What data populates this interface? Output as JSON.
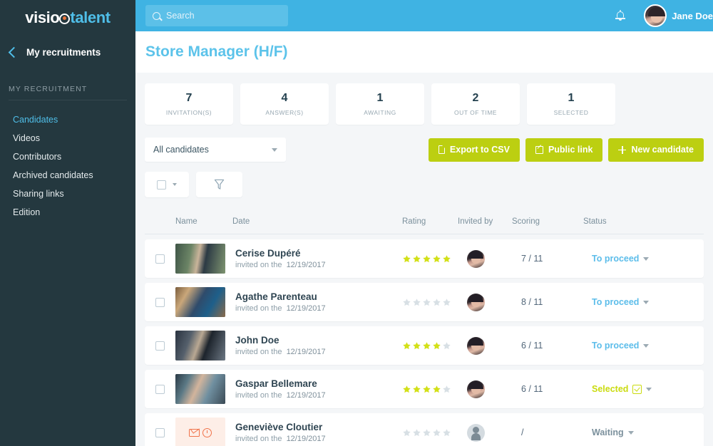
{
  "brand": {
    "logo_part1": "visio",
    "logo_part2": "talent",
    "accent_blue": "#4FBEE8",
    "accent_green": "#BCCF11",
    "sidebar_bg": "#24383F",
    "topbar_bg": "#3FB3E3"
  },
  "sidebar": {
    "back_label": "My recruitments",
    "section_title": "MY RECRUITMENT",
    "items": [
      {
        "label": "Candidates",
        "active": true
      },
      {
        "label": "Videos",
        "active": false
      },
      {
        "label": "Contributors",
        "active": false
      },
      {
        "label": "Archived candidates",
        "active": false
      },
      {
        "label": "Sharing links",
        "active": false
      },
      {
        "label": "Edition",
        "active": false
      }
    ]
  },
  "topbar": {
    "search_placeholder": "Search",
    "search_value": "",
    "user_name": "Jane Doe"
  },
  "page": {
    "title": "Store Manager (H/F)"
  },
  "stats": [
    {
      "value": "7",
      "label": "INVITATION(S)"
    },
    {
      "value": "4",
      "label": "ANSWER(S)"
    },
    {
      "value": "1",
      "label": "AWAITING"
    },
    {
      "value": "2",
      "label": "OUT OF TIME"
    },
    {
      "value": "1",
      "label": "SELECTED"
    }
  ],
  "filter": {
    "selected_option": "All candidates",
    "options": [
      "All candidates"
    ]
  },
  "actions": {
    "export_label": "Export to CSV",
    "public_link_label": "Public link",
    "new_candidate_label": "New candidate"
  },
  "table": {
    "headers": {
      "name": "Name",
      "date": "Date",
      "rating": "Rating",
      "invited_by": "Invited by",
      "scoring": "Scoring",
      "status": "Status"
    },
    "invited_prefix": "invited on the",
    "rows": [
      {
        "name": "Cerise Dupéré",
        "date": "12/19/2017",
        "rating": 5,
        "rating_max": 5,
        "scoring": "7 / 11",
        "status": "To proceed",
        "status_kind": "proceed",
        "has_photo": true,
        "inviter_known": true
      },
      {
        "name": "Agathe Parenteau",
        "date": "12/19/2017",
        "rating": 0,
        "rating_max": 5,
        "scoring": "8 / 11",
        "status": "To proceed",
        "status_kind": "proceed",
        "has_photo": true,
        "inviter_known": true
      },
      {
        "name": "John Doe",
        "date": "12/19/2017",
        "rating": 4,
        "rating_max": 5,
        "scoring": "6 / 11",
        "status": "To proceed",
        "status_kind": "proceed",
        "has_photo": true,
        "inviter_known": true
      },
      {
        "name": "Gaspar Bellemare",
        "date": "12/19/2017",
        "rating": 4,
        "rating_max": 5,
        "scoring": "6 / 11",
        "status": "Selected",
        "status_kind": "selected",
        "has_photo": true,
        "inviter_known": true
      },
      {
        "name": "Geneviève Cloutier",
        "date": "12/19/2017",
        "rating": 0,
        "rating_max": 5,
        "scoring": "/",
        "status": "Waiting",
        "status_kind": "waiting",
        "has_photo": false,
        "inviter_known": false
      }
    ]
  },
  "colors": {
    "star_on": "#D3E017",
    "star_off": "#D8E0E5",
    "status_proceed": "#5CBDEA",
    "status_selected": "#CADB0E",
    "status_waiting": "#7B909C"
  }
}
